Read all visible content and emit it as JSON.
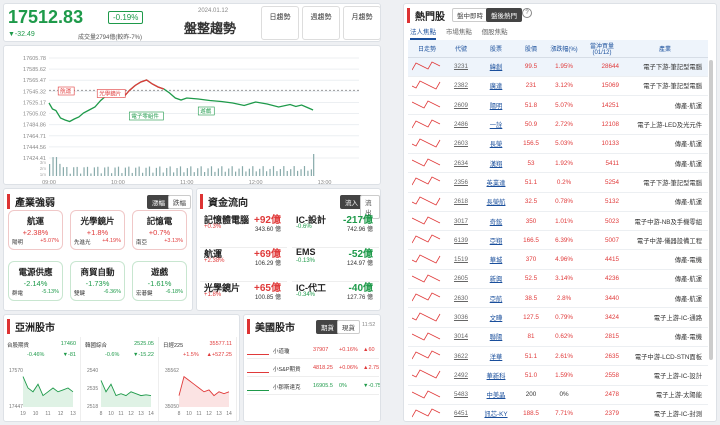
{
  "index": {
    "value": "17512.83",
    "pct": "-0.19%",
    "change": "▼-32.49",
    "volume": "成交量2794億(較昨-7%)",
    "date": "2024.01.12",
    "trend": "盤整趨勢",
    "cycles": [
      "日趨勢",
      "週趨勢",
      "月趨勢"
    ]
  },
  "chart_data": {
    "type": "line",
    "x_ticks": [
      "09:00",
      "10:00",
      "11:00",
      "12:00",
      "13:00"
    ],
    "y_ticks": [
      "17605.78",
      "17585.62",
      "17565.47",
      "17545.32",
      "17525.17",
      "17505.02",
      "17484.86",
      "17464.71",
      "17444.56",
      "17424.41"
    ],
    "ylim": [
      17410,
      17610
    ],
    "vol_ticks": [
      "1m",
      "2m",
      "3m"
    ],
    "annotations": [
      "航運",
      "光學鏡片",
      "電子零組件",
      "遊戲"
    ],
    "points": [
      [
        0,
        17520
      ],
      [
        3,
        17508
      ],
      [
        6,
        17505
      ],
      [
        10,
        17490
      ],
      [
        14,
        17486
      ],
      [
        18,
        17483
      ],
      [
        22,
        17488
      ],
      [
        26,
        17492
      ],
      [
        30,
        17500
      ],
      [
        35,
        17506
      ],
      [
        40,
        17512
      ],
      [
        45,
        17525
      ],
      [
        50,
        17535
      ],
      [
        55,
        17542
      ],
      [
        60,
        17536
      ],
      [
        65,
        17532
      ],
      [
        70,
        17545
      ],
      [
        75,
        17555
      ],
      [
        80,
        17562
      ],
      [
        85,
        17566
      ],
      [
        90,
        17558
      ],
      [
        95,
        17552
      ],
      [
        100,
        17548
      ],
      [
        105,
        17540
      ],
      [
        110,
        17530
      ],
      [
        115,
        17526
      ],
      [
        120,
        17530
      ],
      [
        130,
        17528
      ],
      [
        140,
        17525
      ],
      [
        150,
        17523
      ],
      [
        160,
        17520
      ],
      [
        170,
        17515
      ],
      [
        180,
        17522
      ],
      [
        190,
        17518
      ],
      [
        200,
        17512
      ],
      [
        210,
        17517
      ],
      [
        215,
        17513
      ],
      [
        220,
        17516
      ],
      [
        225,
        17511
      ],
      [
        230,
        17506
      ]
    ]
  },
  "industry": {
    "title": "產業強弱",
    "tabs": [
      "漲幅",
      "跌幅"
    ],
    "tiles": [
      {
        "name": "航運",
        "pct": "+2.38%",
        "stock": "陽明",
        "stock_pct": "+5.07%",
        "up": true
      },
      {
        "name": "光學鏡片",
        "pct": "+1.8%",
        "stock": "先進光",
        "stock_pct": "+4.19%",
        "up": true
      },
      {
        "name": "記憶電",
        "pct": "+0.7%",
        "stock": "南亞",
        "stock_pct": "+3.13%",
        "up": true
      },
      {
        "name": "電源供應",
        "pct": "-2.14%",
        "stock": "群電",
        "stock_pct": "-5.13%",
        "up": false
      },
      {
        "name": "商貿自動",
        "pct": "-1.73%",
        "stock": "雙鍵",
        "stock_pct": "-6.36%",
        "up": false
      },
      {
        "name": "遊戲",
        "pct": "-1.61%",
        "stock": "宏碁鍵",
        "stock_pct": "-6.18%",
        "up": false
      }
    ]
  },
  "capital": {
    "title": "資金流向",
    "tabs": [
      "流入",
      "流出"
    ],
    "items": [
      {
        "name": "記憶體電腦",
        "value": "+92億",
        "pct": "+0.3%",
        "sub": "343.60 億",
        "up": true
      },
      {
        "name": "IC-設計",
        "value": "-217億",
        "pct": "-0.6%",
        "sub": "742.96 億",
        "up": false
      },
      {
        "name": "航運",
        "value": "+69億",
        "pct": "+2.38%",
        "sub": "106.29 億",
        "up": true
      },
      {
        "name": "EMS",
        "value": "-52億",
        "pct": "-0.13%",
        "sub": "124.97 億",
        "up": false
      },
      {
        "name": "光學鏡片",
        "value": "+65億",
        "pct": "+1.8%",
        "sub": "100.85 億",
        "up": true
      },
      {
        "name": "IC-代工",
        "value": "-40億",
        "pct": "-0.34%",
        "sub": "127.76 億",
        "up": false
      }
    ]
  },
  "asia": {
    "title": "亞洲股市",
    "markets": [
      {
        "name": "台股期貨",
        "value": "17460",
        "pct": "-0.46%",
        "chg": "▼-81",
        "ticks": [
          "17570",
          "17447"
        ],
        "xt": [
          "19",
          "10",
          "11",
          "12",
          "13"
        ]
      },
      {
        "name": "韓國綜合",
        "value": "2525.05",
        "pct": "-0.6%",
        "chg": "▼-15.22",
        "ticks": [
          "2540",
          "2535",
          "2518"
        ],
        "xt": [
          "8",
          "10",
          "11",
          "12",
          "13",
          "14"
        ]
      },
      {
        "name": "日經225",
        "value": "35577.11",
        "pct": "+1.5%",
        "chg": "▲+527.25",
        "ticks": [
          "35562",
          "35050"
        ],
        "xt": [
          "8",
          "10",
          "11",
          "12",
          "13",
          "14"
        ]
      }
    ]
  },
  "us": {
    "title": "美國股市",
    "tabs": [
      "期貨",
      "現貨"
    ],
    "time": "11:52",
    "rows": [
      {
        "name": "小道瓊",
        "value": "37907",
        "pct": "+0.16%",
        "chg": "▲60",
        "up": true
      },
      {
        "name": "小S&P期貨",
        "value": "4818.25",
        "pct": "+0.06%",
        "chg": "▲2.75",
        "up": true
      },
      {
        "name": "小那斯達克",
        "value": "16905.5",
        "pct": "0%",
        "chg": "▼-0.75",
        "up": false
      }
    ]
  },
  "hot": {
    "title": "熱門股",
    "tabs": [
      "盤中即時",
      "盤後熱門"
    ],
    "help": "?",
    "subtabs": [
      "法人焦點",
      "市場焦點",
      "個股焦點"
    ],
    "headers": [
      "日走勢",
      "代號",
      "股票",
      "股價",
      "漲跌幅(%)",
      "當沖買量(01/12)",
      "產業"
    ],
    "rows": [
      [
        "3231",
        "緯創",
        "99.5",
        "1.95%",
        "28644",
        "電子下游-筆記型電腦"
      ],
      [
        "2382",
        "廣達",
        "231",
        "3.12%",
        "15069",
        "電子下游-筆記型電腦"
      ],
      [
        "2609",
        "陽明",
        "51.8",
        "5.07%",
        "14251",
        "傳產-航運"
      ],
      [
        "2486",
        "一詮",
        "50.9",
        "2.72%",
        "12108",
        "電子上游-LED及光元件"
      ],
      [
        "2603",
        "長榮",
        "156.5",
        "5.03%",
        "10133",
        "傳產-航運"
      ],
      [
        "2634",
        "漢翔",
        "53",
        "1.92%",
        "5411",
        "傳產-航運"
      ],
      [
        "2356",
        "英業達",
        "51.1",
        "0.2%",
        "5254",
        "電子下游-筆記型電腦"
      ],
      [
        "2618",
        "長榮航",
        "32.5",
        "0.78%",
        "5132",
        "傳產-航運"
      ],
      [
        "3017",
        "奇鋐",
        "350",
        "1.01%",
        "5023",
        "電子中游-NB及手機零組"
      ],
      [
        "6139",
        "亞翔",
        "166.5",
        "6.39%",
        "5007",
        "電子中游-儀器設備工程"
      ],
      [
        "1519",
        "華城",
        "370",
        "4.96%",
        "4415",
        "傳產-電機"
      ],
      [
        "2605",
        "新興",
        "52.5",
        "3.14%",
        "4236",
        "傳產-航運"
      ],
      [
        "2630",
        "亞航",
        "38.5",
        "2.8%",
        "3440",
        "傳產-航運"
      ],
      [
        "3036",
        "文曄",
        "127.5",
        "0.79%",
        "3424",
        "電子上游-IC-通路"
      ],
      [
        "3014",
        "聯陽",
        "81",
        "0.62%",
        "2815",
        "傳產-電機"
      ],
      [
        "3622",
        "洋華",
        "51.1",
        "2.61%",
        "2635",
        "電子中游-LCD-STN面板"
      ],
      [
        "2492",
        "華新科",
        "51.0",
        "1.59%",
        "2558",
        "電子上游-IC-設計"
      ],
      [
        "5483",
        "中美晶",
        "200",
        "0%",
        "2478",
        "電子上游-太陽能"
      ],
      [
        "6451",
        "訊芯-KY",
        "188.5",
        "7.71%",
        "2379",
        "電子上游-IC-封測"
      ]
    ]
  }
}
